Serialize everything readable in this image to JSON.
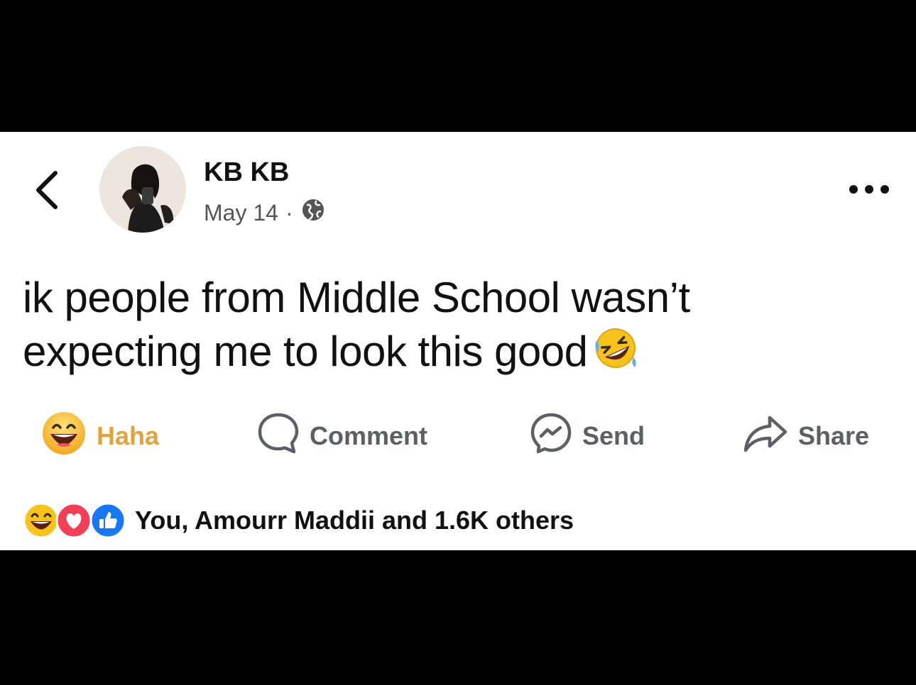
{
  "post": {
    "author": "KB KB",
    "date": "May 14",
    "separator": "·",
    "privacy_icon": "globe-icon",
    "text_line1": "ik people from Middle School wasn’t",
    "text_line2": "expecting me to look this good",
    "text_emoji": "rolling-on-floor-laughing-emoji"
  },
  "actions": {
    "reaction_label": "Haha",
    "comment_label": "Comment",
    "send_label": "Send",
    "share_label": "Share"
  },
  "reactions": {
    "icons": [
      "haha-reaction-icon",
      "love-reaction-icon",
      "like-reaction-icon"
    ],
    "summary": "You, Amourr Maddii and 1.6K others"
  },
  "colors": {
    "haha_accent": "#e2a33c",
    "like_blue": "#1877f2",
    "love_red": "#f33e58"
  }
}
